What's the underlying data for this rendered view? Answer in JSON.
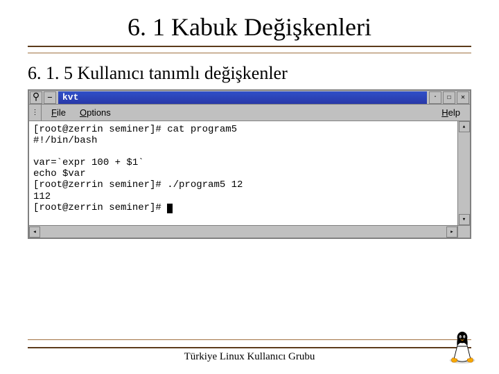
{
  "title": "6. 1 Kabuk Değişkenleri",
  "subtitle": "6. 1. 5 Kullanıcı tanımlı değişkenler",
  "window": {
    "app_title": "kvt",
    "menu": {
      "file": "File",
      "options": "Options",
      "help": "Help"
    },
    "terminal_lines": [
      "[root@zerrin seminer]# cat program5",
      "#!/bin/bash",
      "",
      "var=`expr 100 + $1`",
      "echo $var",
      "[root@zerrin seminer]# ./program5 12",
      "112",
      "[root@zerrin seminer]# "
    ]
  },
  "footer": "Türkiye Linux Kullanıcı Grubu",
  "icons": {
    "pin": "⚲",
    "dash": "–",
    "min": "·",
    "max": "☐",
    "close": "✕",
    "up": "▴",
    "down": "▾",
    "left": "◂",
    "right": "▸"
  }
}
